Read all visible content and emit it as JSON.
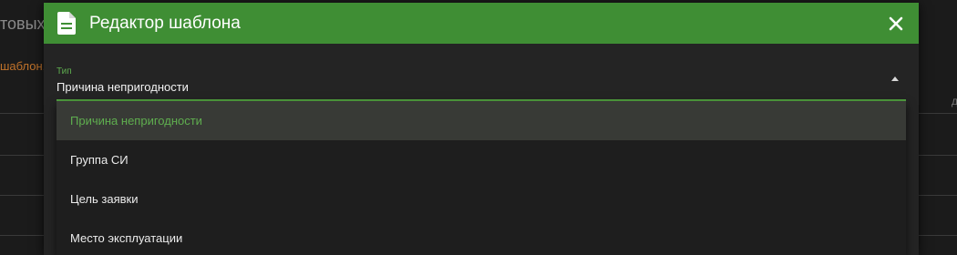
{
  "background": {
    "heading_fragment": "товых",
    "hint_fragment": "шаблон,",
    "right_fragment": "д"
  },
  "dialog": {
    "title": "Редактор шаблона",
    "icon": "document-icon",
    "close_icon": "close-icon",
    "header_color": "#3f8e34"
  },
  "field": {
    "label": "Тип",
    "value": "Причина непригодности",
    "arrow_icon": "arrow-up-icon",
    "accent_color": "#52a341"
  },
  "menu": {
    "items": [
      {
        "label": "Причина непригодности",
        "selected": true
      },
      {
        "label": "Группа СИ",
        "selected": false
      },
      {
        "label": "Цель заявки",
        "selected": false
      },
      {
        "label": "Место эксплуатации",
        "selected": false
      }
    ]
  }
}
